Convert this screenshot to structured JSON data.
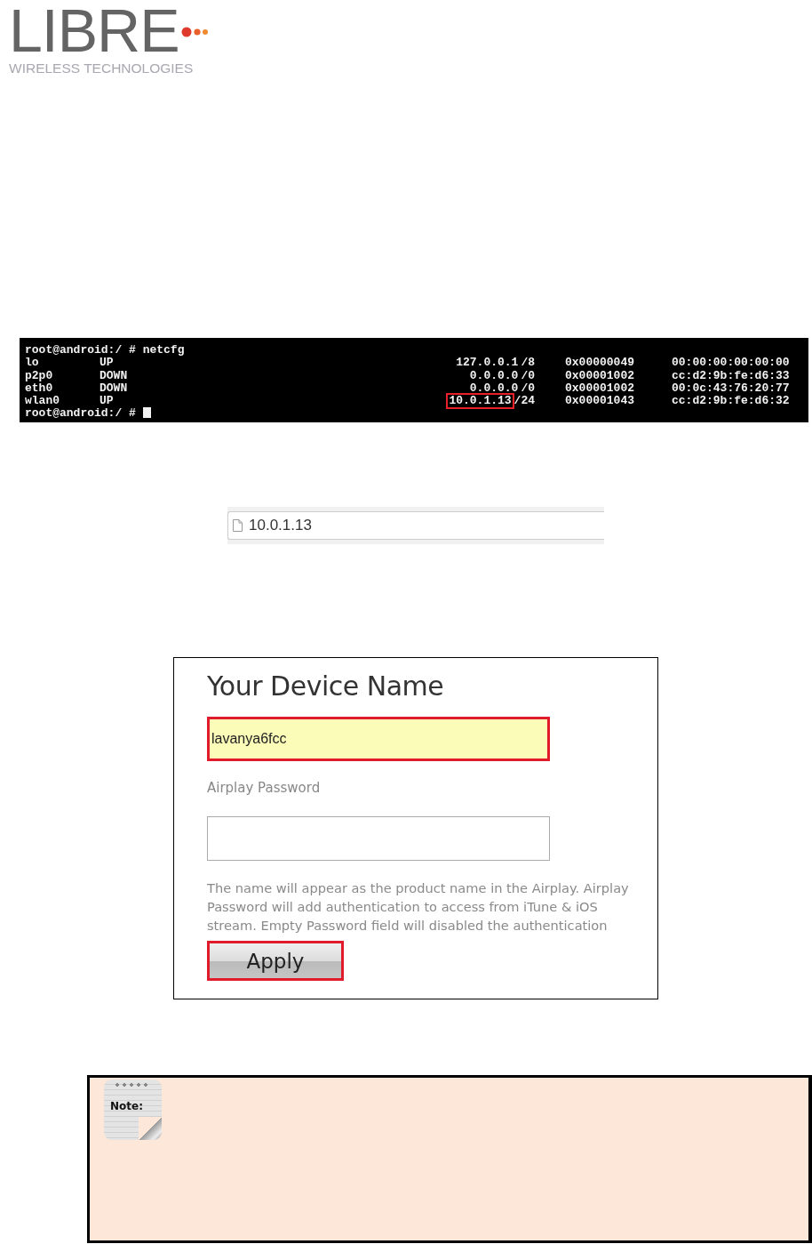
{
  "logo": {
    "name": "LIBRE",
    "tagline": "WIRELESS TECHNOLOGIES"
  },
  "terminal": {
    "command_line": {
      "prompt": "root@android:/ #",
      "command": "netcfg"
    },
    "rows": [
      {
        "interface": "lo",
        "state": "UP",
        "address": "127.0.0.1",
        "mask": "/8",
        "highlighted": false,
        "flags": "0x00000049",
        "mac": "00:00:00:00:00:00"
      },
      {
        "interface": "p2p0",
        "state": "DOWN",
        "address": "0.0.0.0",
        "mask": "/0",
        "highlighted": false,
        "flags": "0x00001002",
        "mac": "cc:d2:9b:fe:d6:33"
      },
      {
        "interface": "eth0",
        "state": "DOWN",
        "address": "0.0.0.0",
        "mask": "/0",
        "highlighted": false,
        "flags": "0x00001002",
        "mac": "00:0c:43:76:20:77"
      },
      {
        "interface": "wlan0",
        "state": "UP",
        "address": "10.0.1.13",
        "mask": "/24",
        "highlighted": true,
        "flags": "0x00001043",
        "mac": "cc:d2:9b:fe:d6:32"
      }
    ],
    "final_prompt": "root@android:/ #"
  },
  "address_bar": {
    "value": "10.0.1.13"
  },
  "device_form": {
    "title": "Your Device Name",
    "name_field": {
      "value": "lavanya6fcc",
      "highlighted": true
    },
    "password_label": "Airplay Password",
    "password_field": {
      "highlighted": false
    },
    "help_text": "The name will appear as the product name in the Airplay. Airplay Password will add authentication to access from iTune & iOS stream. Empty Password field will disabled the authentication",
    "apply_button": {
      "label": "Apply",
      "highlighted": true
    }
  },
  "note": {
    "icon_label": "Note:"
  }
}
